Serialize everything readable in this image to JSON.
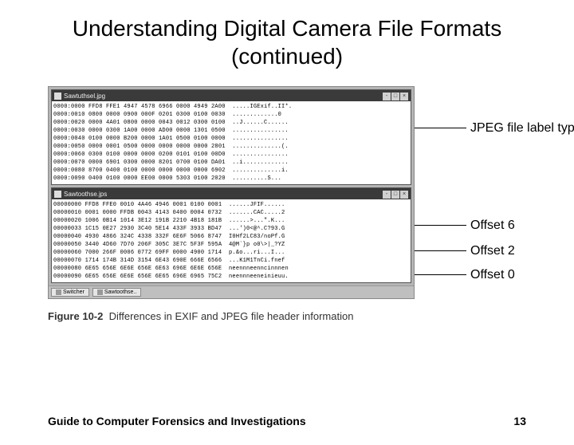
{
  "title": "Understanding Digital Camera File Formats (continued)",
  "footer_left": "Guide to Computer Forensics and Investigations",
  "footer_right": "13",
  "caption_num": "Figure 10-2",
  "caption_text": "Differences in EXIF and JPEG file header information",
  "labels": {
    "jpeg_types": "JPEG file label types",
    "offset6": "Offset 6",
    "offset2": "Offset 2",
    "offset0": "Offset 0"
  },
  "win1": {
    "title": "Sawtuthsel.jpg",
    "rows": [
      "0000:0000 FFD8 FFE1 4947 4578 6966 0000 4949 2A00  .....IGExif..II*.",
      "0000:0010 0800 0000 0900 000F 0201 0300 0100 0030  .............0",
      "0000:0020 0000 4A01 0800 0000 0043 0012 0300 0100  ..J......C......",
      "0000:0030 0000 0300 1A00 0000 AD00 0000 1301 0500  ................",
      "0000:0040 0100 0000 B200 0000 1A01 0500 0100 0000  ................",
      "0000:0050 0000 0001 0500 0000 0000 0000 0000 2801  ..............(.",
      "0000:0060 0300 0100 0000 0000 0200 0101 0100 00D0  ................",
      "0000:0070 0000 6901 0300 0000 8201 0700 0100 DA01  ..i.............",
      "0000:0080 8700 0400 0100 0000 0000 0000 0000 6902  ..............i.",
      "0000:0090 0400 0100 0000 EE00 0000 5303 0100 2020  ..........S...  "
    ]
  },
  "win2": {
    "title": "Sawtoothse.jps",
    "rows": [
      "00000000 FFD8 FFE0 0010 4A46 4946 0001 0100 0001  ......JFIF......",
      "00000010 0001 0000 FFDB 0043 4143 0400 0004 0732  .......CAC.....2",
      "00000020 1006 0B14 1014 3E12 191B 2210 4B18 181B  ......>...\".K...",
      "00000033 1C15 0E27 2930 3C40 5E14 433F 3933 BD47  ...')0<@^.C?93.G",
      "00000040 4930 4866 324C 4338 332F 6E6F 5066 8747  I0Hf2LC83/noPf.G",
      "00000050 3440 4D60 7D70 206F 305C 3E7C 5F3F 595A  4@M`}p o0\\>|_?YZ",
      "00000060 7000 266F 0006 0772 69FF 0000 4900 1714  p.&o...ri...I...",
      "00000070 1714 174B 314D 3154 6E43 690E 666E 6566  ...K1M1TnCi.fnef",
      "00000080 6E65 656E 6E6E 656E 6E63 696E 6E6E 656E  neennneenncinnnen",
      "00000090 6E65 656E 6E6E 656E 6E65 696E 6965 75C2  neennneeneinieuu."
    ]
  },
  "taskbar": {
    "btn1": "Switcher",
    "btn2": "Sawtoothse.."
  }
}
